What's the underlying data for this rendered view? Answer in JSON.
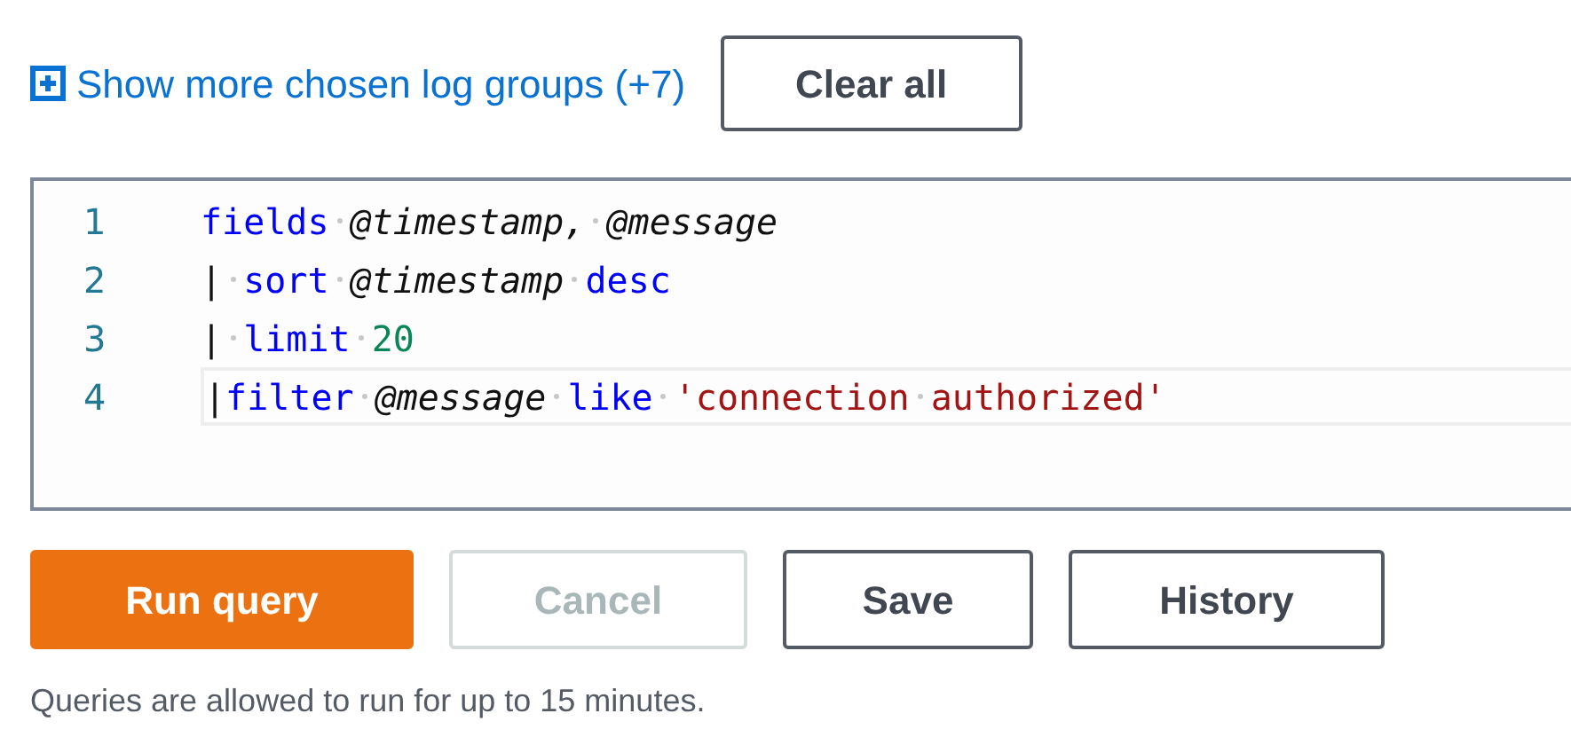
{
  "log_groups_link": {
    "label": "Show more chosen log groups (+7)"
  },
  "clear_button": {
    "label": "Clear all"
  },
  "editor": {
    "lines": [
      {
        "number": "1",
        "active": false,
        "tokens": [
          {
            "kind": "keyword",
            "text": "fields"
          },
          {
            "kind": "space"
          },
          {
            "kind": "field",
            "text": "@timestamp,"
          },
          {
            "kind": "space"
          },
          {
            "kind": "field",
            "text": "@message"
          }
        ]
      },
      {
        "number": "2",
        "active": false,
        "tokens": [
          {
            "kind": "plain",
            "text": "|"
          },
          {
            "kind": "space"
          },
          {
            "kind": "keyword",
            "text": "sort"
          },
          {
            "kind": "space"
          },
          {
            "kind": "field",
            "text": "@timestamp"
          },
          {
            "kind": "space"
          },
          {
            "kind": "keyword",
            "text": "desc"
          }
        ]
      },
      {
        "number": "3",
        "active": false,
        "tokens": [
          {
            "kind": "plain",
            "text": "|"
          },
          {
            "kind": "space"
          },
          {
            "kind": "keyword",
            "text": "limit"
          },
          {
            "kind": "space"
          },
          {
            "kind": "number",
            "text": "20"
          }
        ]
      },
      {
        "number": "4",
        "active": true,
        "tokens": [
          {
            "kind": "plain",
            "text": "|"
          },
          {
            "kind": "keyword",
            "text": "filter"
          },
          {
            "kind": "space"
          },
          {
            "kind": "field",
            "text": "@message"
          },
          {
            "kind": "space"
          },
          {
            "kind": "keyword",
            "text": "like"
          },
          {
            "kind": "space"
          },
          {
            "kind": "string",
            "text": "'connection"
          },
          {
            "kind": "space"
          },
          {
            "kind": "string",
            "text": "authorized'"
          }
        ]
      }
    ]
  },
  "buttons": [
    {
      "kind": "primary",
      "label": "Run query",
      "disabled": false
    },
    {
      "kind": "normal",
      "label": "Cancel",
      "disabled": true
    },
    {
      "kind": "normal",
      "label": "Save",
      "disabled": false
    },
    {
      "kind": "normal",
      "label": "History",
      "disabled": false
    }
  ],
  "hint": "Queries are allowed to run for up to 15 minutes."
}
